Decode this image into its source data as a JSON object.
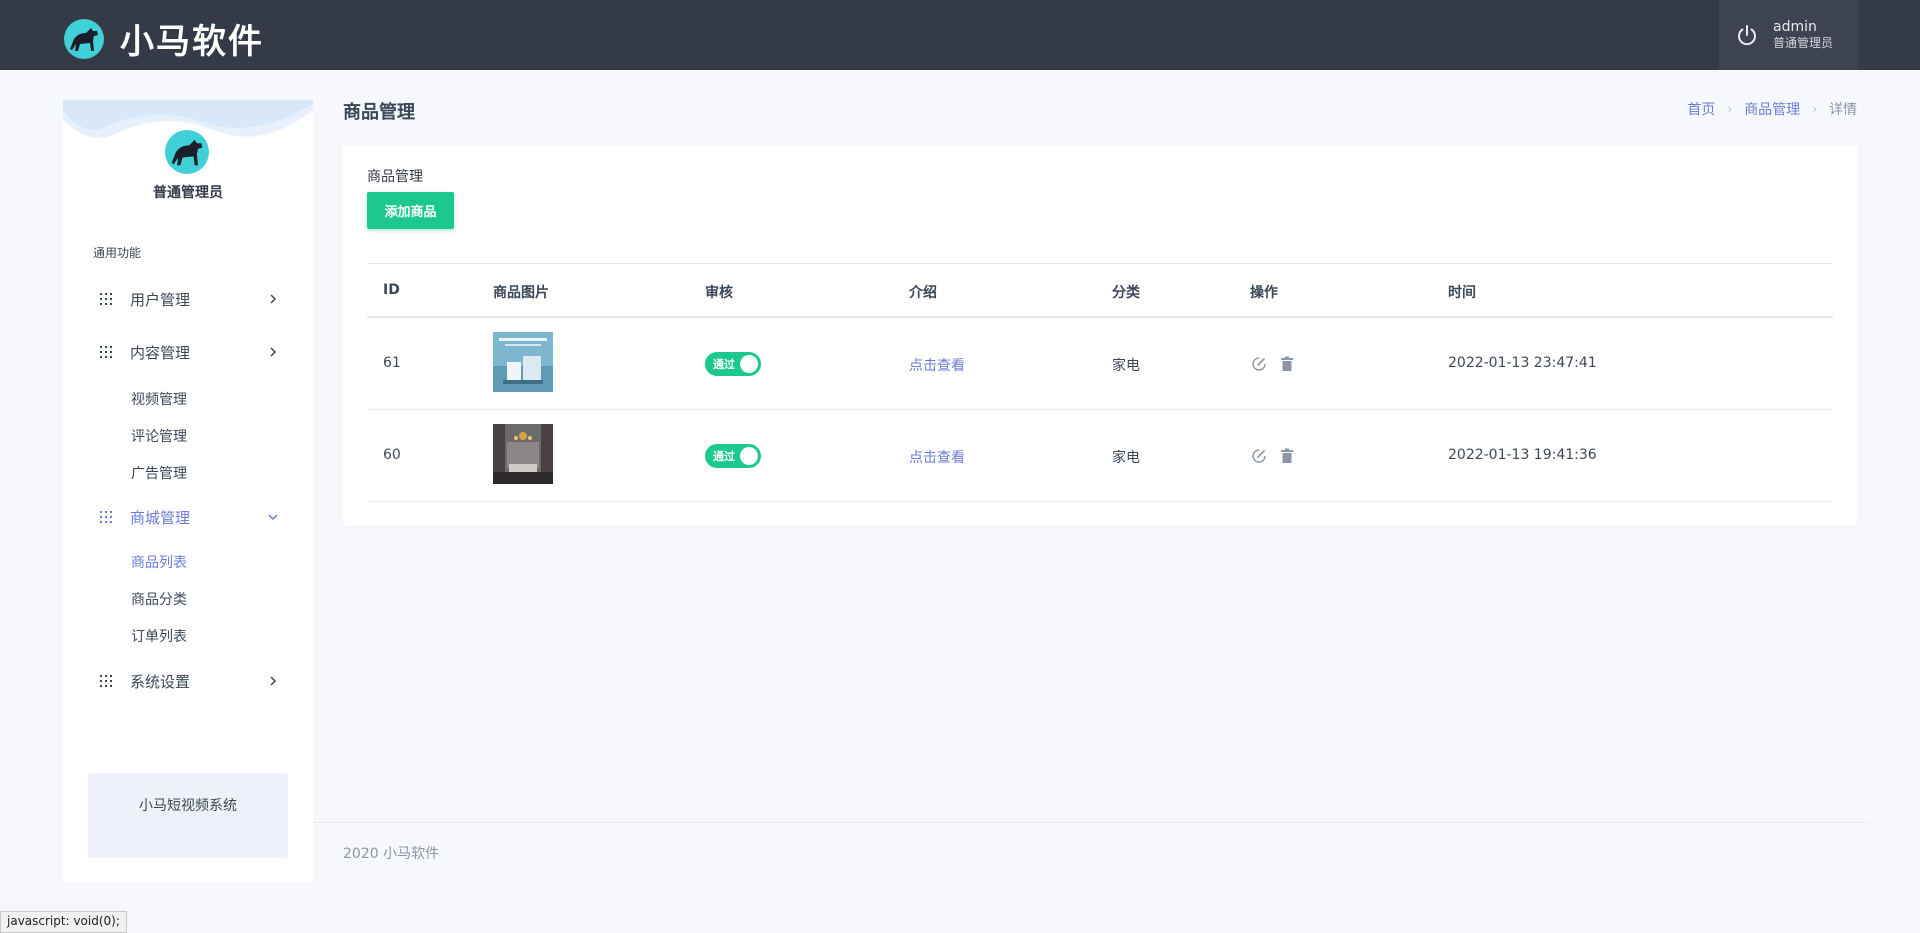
{
  "app": {
    "brand_name": "小马软件"
  },
  "header": {
    "user_name": "admin",
    "user_role": "普通管理员"
  },
  "sidebar": {
    "role": "普通管理员",
    "section_title": "通用功能",
    "items": [
      {
        "label": "用户管理"
      },
      {
        "label": "内容管理"
      },
      {
        "label": "视频管理"
      },
      {
        "label": "评论管理"
      },
      {
        "label": "广告管理"
      },
      {
        "label": "商城管理"
      },
      {
        "label": "商品列表"
      },
      {
        "label": "商品分类"
      },
      {
        "label": "订单列表"
      },
      {
        "label": "系统设置"
      }
    ],
    "card_text": "小马短视频系统"
  },
  "page": {
    "title": "商品管理",
    "breadcrumb": [
      "首页",
      "商品管理",
      "详情"
    ]
  },
  "card": {
    "title": "商品管理",
    "add_button": "添加商品"
  },
  "table": {
    "columns": [
      "ID",
      "商品图片",
      "审核",
      "介绍",
      "分类",
      "操作",
      "时间"
    ],
    "rows": [
      {
        "id": "61",
        "audit": "通过",
        "intro": "点击查看",
        "category": "家电",
        "time": "2022-01-13 23:47:41"
      },
      {
        "id": "60",
        "audit": "通过",
        "intro": "点击查看",
        "category": "家电",
        "time": "2022-01-13 19:41:36"
      }
    ]
  },
  "footer": {
    "text": "2020 小马软件"
  },
  "status_bar": {
    "text": "javascript: void(0);"
  },
  "colors": {
    "topbar": "#343a46",
    "accent": "#6c7bd9",
    "success": "#1bc88f",
    "background": "#f6f8fc"
  }
}
